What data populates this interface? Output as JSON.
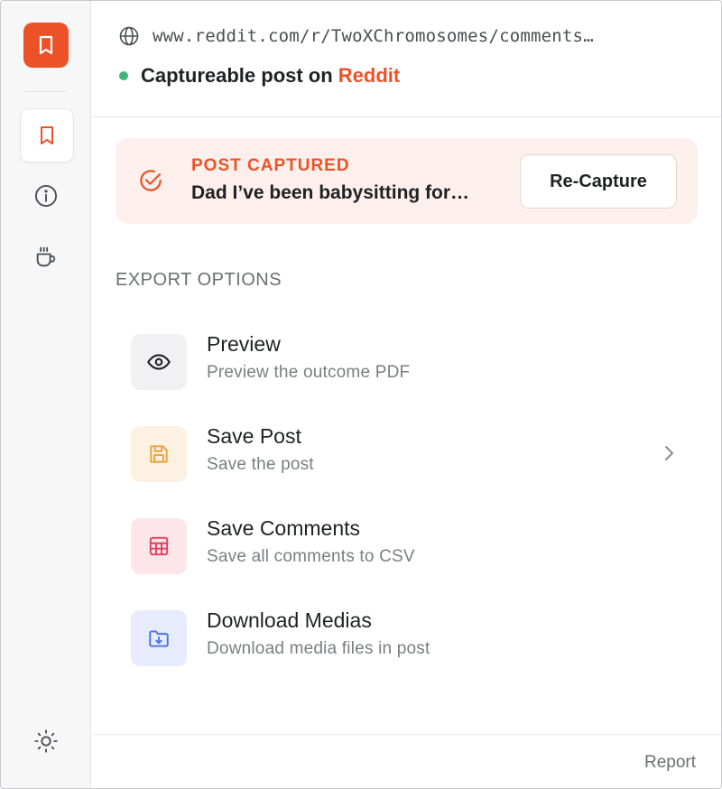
{
  "header": {
    "url": "www.reddit.com/r/TwoXChromosomes/comments…",
    "status_prefix": "Captureable post on ",
    "status_brand": "Reddit"
  },
  "capture": {
    "kicker": "POST CAPTURED",
    "title": "Dad I’ve been babysitting for…",
    "button": "Re-Capture"
  },
  "export": {
    "section_label": "EXPORT OPTIONS",
    "options": [
      {
        "title": "Preview",
        "subtitle": "Preview the outcome PDF",
        "icon": "eye-icon"
      },
      {
        "title": "Save Post",
        "subtitle": "Save the post",
        "icon": "floppy-icon"
      },
      {
        "title": "Save Comments",
        "subtitle": "Save all comments to CSV",
        "icon": "table-icon"
      },
      {
        "title": "Download Medias",
        "subtitle": "Download media files in post",
        "icon": "folder-download-icon"
      }
    ]
  },
  "sidebar": {
    "items": [
      {
        "icon": "bookmark-icon"
      },
      {
        "icon": "info-icon"
      },
      {
        "icon": "coffee-icon"
      }
    ],
    "theme_icon": "sun-icon"
  },
  "footer": {
    "report": "Report"
  },
  "colors": {
    "brand": "#ec5228",
    "status_green": "#3fb67a",
    "card_bg": "#fdf0ec",
    "preview_bg": "#f1f1f3",
    "save_post_bg": "#fdf1e3",
    "save_post_fg": "#e9a23b",
    "comments_bg": "#fde6ea",
    "comments_fg": "#e2405f",
    "media_bg": "#e6ecfd",
    "media_fg": "#4a74e8"
  }
}
